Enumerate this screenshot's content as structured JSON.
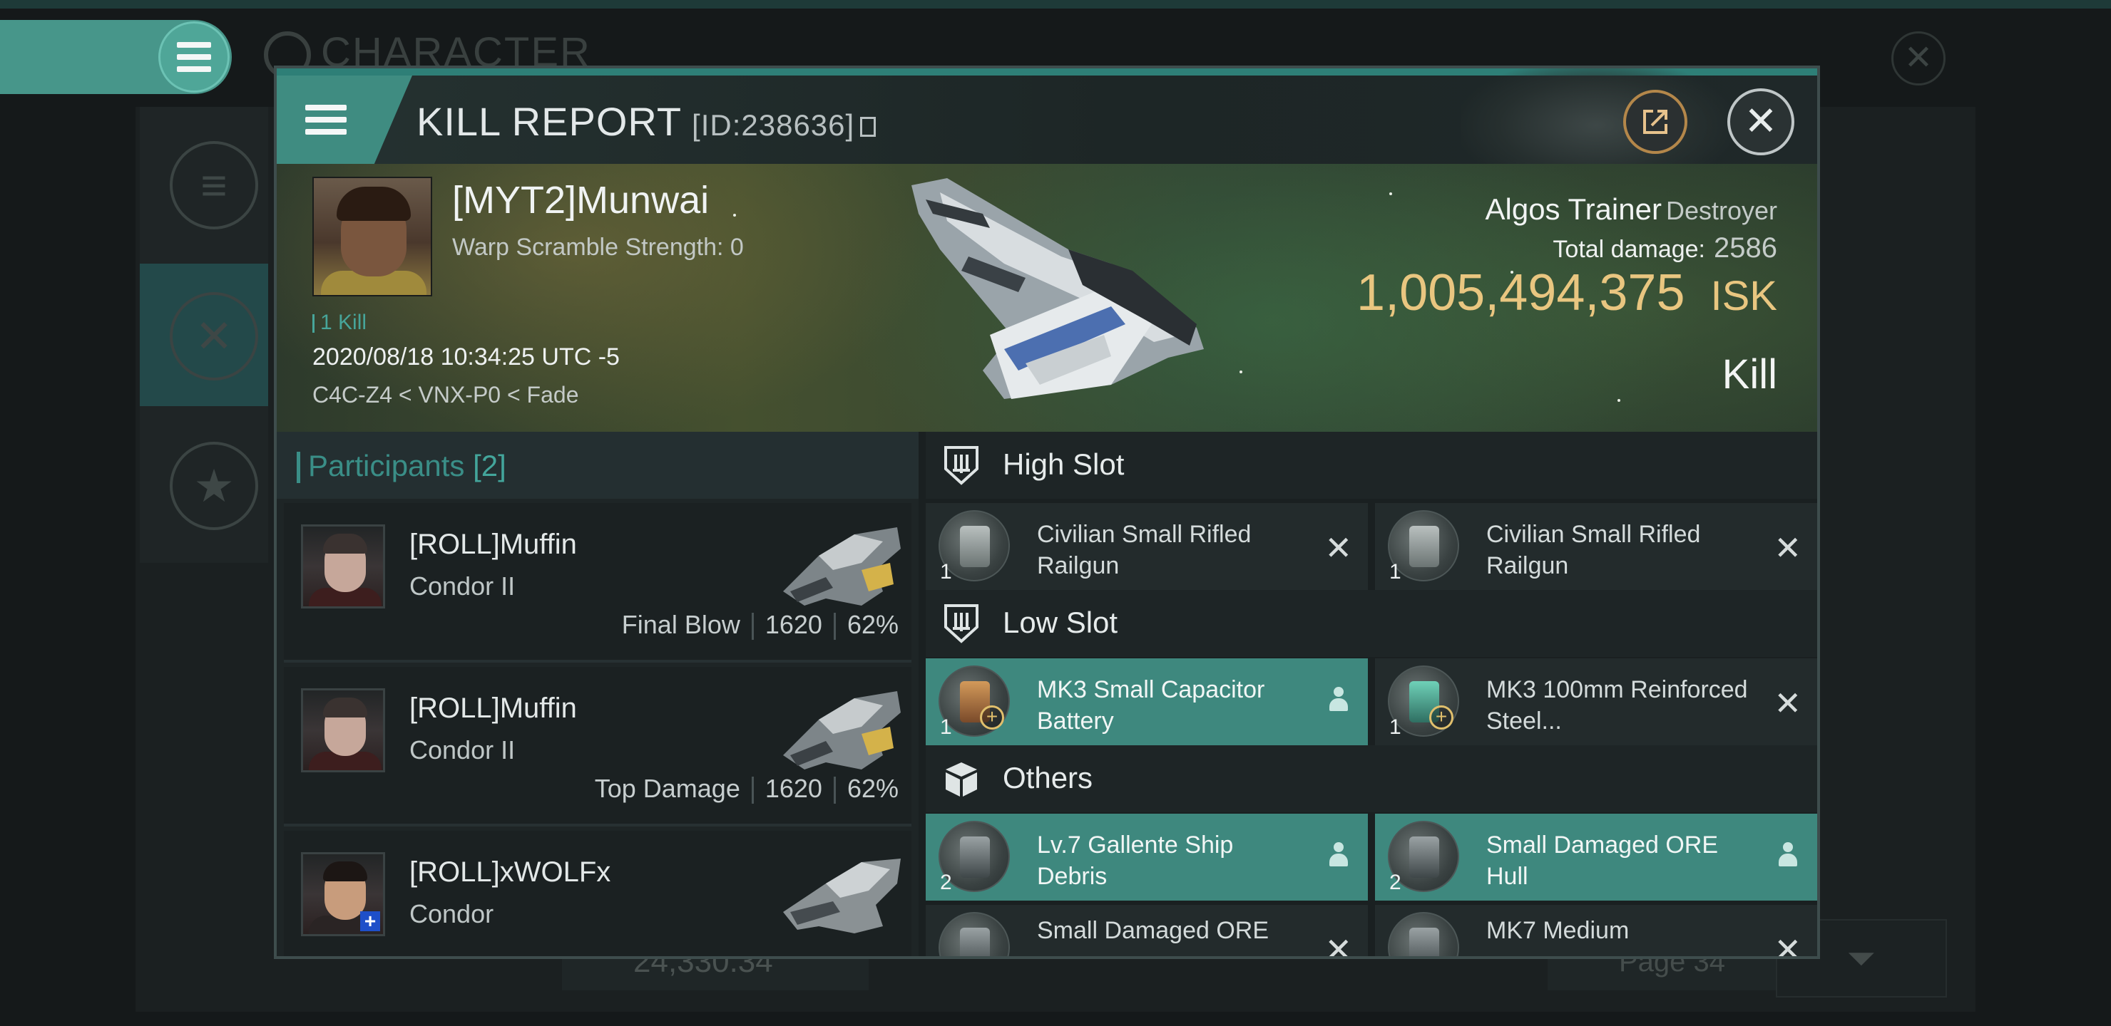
{
  "background": {
    "title": "CHARACTER",
    "bottom_value": "24,330.34",
    "page_label": "Page 34"
  },
  "header": {
    "title": "KILL REPORT",
    "id_label": "[ID:238636]"
  },
  "victim": {
    "name": "[MYT2]Munwai",
    "warp_scramble": "Warp Scramble Strength: 0",
    "kill_tag": "1 Kill",
    "datetime": "2020/08/18 10:34:25 UTC -5",
    "location": "C4C-Z4 < VNX-P0 < Fade",
    "ship_name": "Algos Trainer",
    "ship_class": "Destroyer",
    "total_damage_label": "Total damage:",
    "total_damage_value": "2586",
    "isk_value": "1,005,494,375",
    "isk_unit": "ISK",
    "result": "Kill"
  },
  "participants": {
    "label": "Participants",
    "count": "[2]",
    "rows": [
      {
        "name": "[ROLL]Muffin",
        "ship": "Condor II",
        "role": "Final Blow",
        "damage": "1620",
        "percent": "62%"
      },
      {
        "name": "[ROLL]Muffin",
        "ship": "Condor II",
        "role": "Top Damage",
        "damage": "1620",
        "percent": "62%"
      },
      {
        "name": "[ROLL]xWOLFx",
        "ship": "Condor"
      }
    ]
  },
  "slots": {
    "high": {
      "label": "High Slot",
      "items": [
        {
          "name": "Civilian Small Rifled Railgun",
          "qty": "1"
        },
        {
          "name": "Civilian Small Rifled Railgun",
          "qty": "1"
        }
      ]
    },
    "low": {
      "label": "Low Slot",
      "items": [
        {
          "name": "MK3 Small Capacitor Battery",
          "qty": "1"
        },
        {
          "name": "MK3 100mm Reinforced Steel...",
          "qty": "1"
        }
      ]
    },
    "others": {
      "label": "Others",
      "items": [
        {
          "name": "Lv.7 Gallente Ship Debris",
          "qty": "2"
        },
        {
          "name": "Small Damaged ORE Hull",
          "qty": "2"
        },
        {
          "name": "Small Damaged ORE",
          "qty": ""
        },
        {
          "name": "MK7 Medium",
          "qty": ""
        }
      ]
    }
  },
  "colors": {
    "accent_teal": "#3e887e",
    "isk_gold": "#e9c680",
    "share_ring": "#b4874a"
  }
}
